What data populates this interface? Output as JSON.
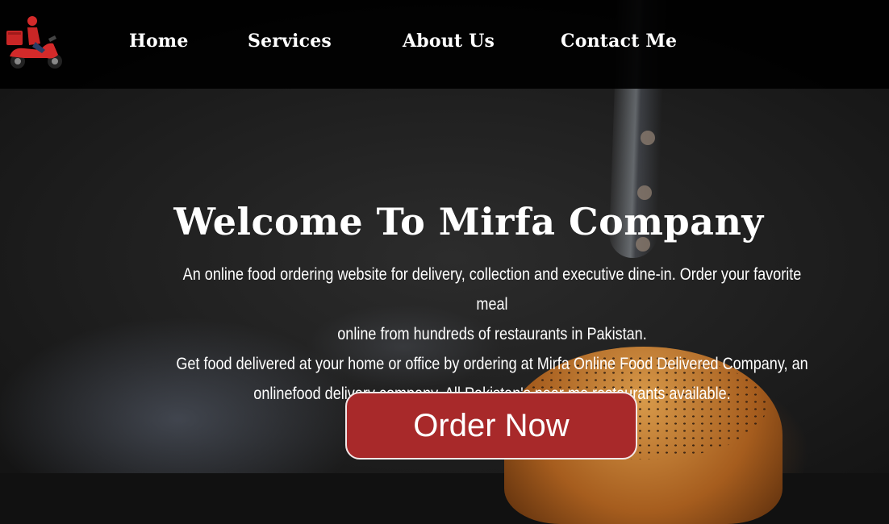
{
  "brand": {
    "logo_icon": "scooter-delivery-icon",
    "accent_color": "#a8292a"
  },
  "nav": {
    "items": [
      {
        "label": "Home"
      },
      {
        "label": "Services"
      },
      {
        "label": "About Us"
      },
      {
        "label": "Contact Me"
      }
    ]
  },
  "hero": {
    "title": "Welcome To Mirfa Company",
    "lines": [
      "An online food ordering website for delivery, collection and executive dine-in. Order your favorite meal",
      "online from hundreds of restaurants in Pakistan.",
      "Get food delivered at your home or office by ordering at Mirfa Online Food Delivered Company, an",
      "onlinefood delivery company. All Pakistan's near me restaurants available."
    ],
    "cta_label": "Order Now"
  }
}
